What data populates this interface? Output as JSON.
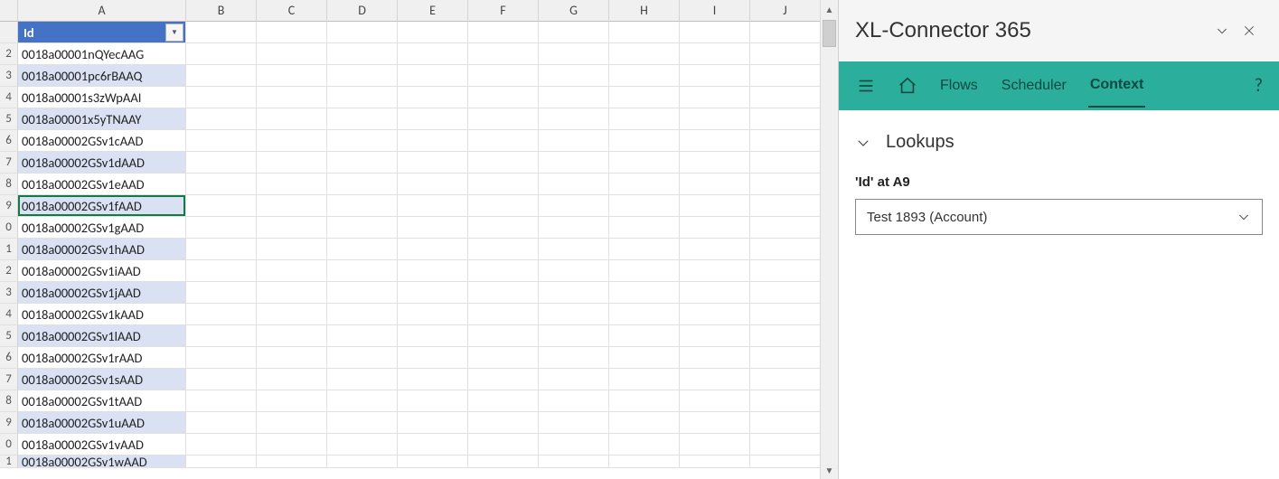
{
  "spreadsheet": {
    "columns": [
      "A",
      "B",
      "C",
      "D",
      "E",
      "F",
      "G",
      "H",
      "I",
      "J"
    ],
    "header_label": "Id",
    "selected_row_index": 8,
    "row_numbers": [
      "",
      "2",
      "3",
      "4",
      "5",
      "6",
      "7",
      "8",
      "9",
      "0",
      "1",
      "2",
      "3",
      "4",
      "5",
      "6",
      "7",
      "8",
      "9",
      "0",
      "1"
    ],
    "rows": [
      "0018a00001nQYecAAG",
      "0018a00001pc6rBAAQ",
      "0018a00001s3zWpAAI",
      "0018a00001x5yTNAAY",
      "0018a00002GSv1cAAD",
      "0018a00002GSv1dAAD",
      "0018a00002GSv1eAAD",
      "0018a00002GSv1fAAD",
      "0018a00002GSv1gAAD",
      "0018a00002GSv1hAAD",
      "0018a00002GSv1iAAD",
      "0018a00002GSv1jAAD",
      "0018a00002GSv1kAAD",
      "0018a00002GSv1lAAD",
      "0018a00002GSv1rAAD",
      "0018a00002GSv1sAAD",
      "0018a00002GSv1tAAD",
      "0018a00002GSv1uAAD",
      "0018a00002GSv1vAAD",
      "0018a00002GSv1wAAD"
    ]
  },
  "pane": {
    "title": "XL-Connector 365",
    "nav": {
      "flows": "Flows",
      "scheduler": "Scheduler",
      "context": "Context",
      "help": "?"
    },
    "section_title": "Lookups",
    "field_label": "'Id' at A9",
    "dropdown_value": "Test 1893 (Account)"
  }
}
